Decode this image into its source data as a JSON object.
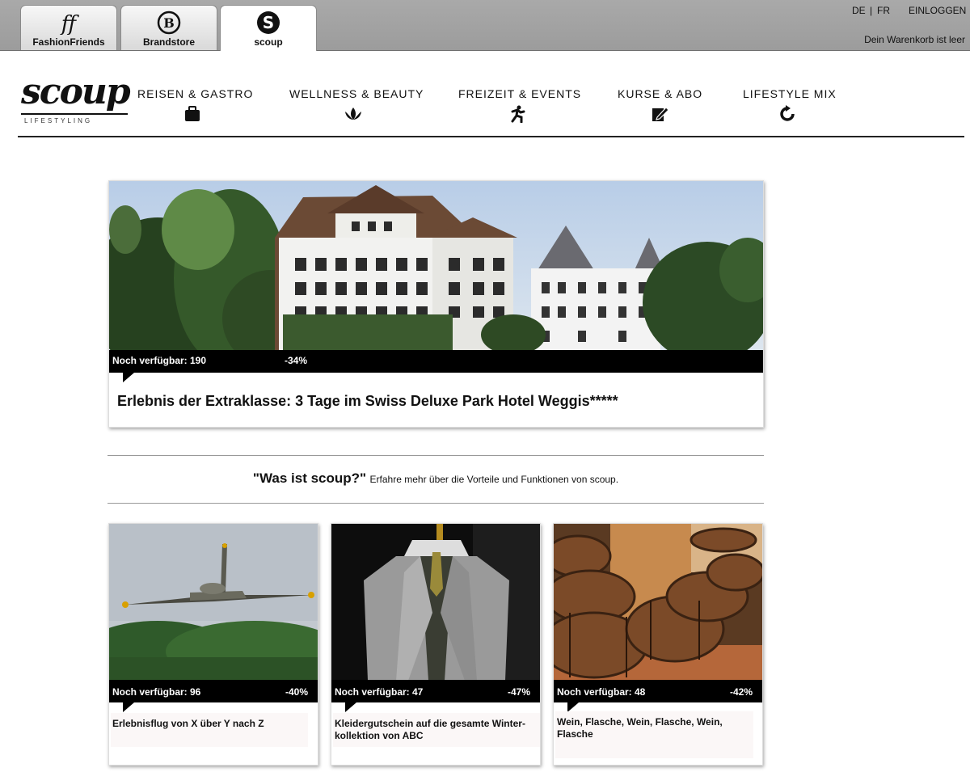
{
  "tabs": [
    {
      "label": "FashionFriends",
      "icon": "fashionfriends-logo-icon"
    },
    {
      "label": "Brandstore",
      "icon": "brandstore-logo-icon"
    },
    {
      "label": "scoup",
      "icon": "scoup-logo-icon"
    }
  ],
  "lang": {
    "de": "DE",
    "sep": "|",
    "fr": "FR"
  },
  "login": "EINLOGGEN",
  "cart": "Dein Warenkorb ist leer",
  "logo": {
    "word": "scoup",
    "sub": "LIFESTYLING"
  },
  "nav": [
    {
      "label": "REISEN & GASTRO",
      "icon": "suitcase-icon"
    },
    {
      "label": "WELLNESS & BEAUTY",
      "icon": "lotus-icon"
    },
    {
      "label": "FREIZEIT & EVENTS",
      "icon": "runner-icon"
    },
    {
      "label": "KURSE & ABO",
      "icon": "edit-pen-icon"
    },
    {
      "label": "LIFESTYLE MIX",
      "icon": "refresh-arrow-icon"
    }
  ],
  "hero": {
    "avail": "Noch verfügbar: 190",
    "discount": "-34%",
    "title": "Erlebnis der Extraklasse: 3 Tage im Swiss Deluxe Park Hotel Weggis*****"
  },
  "info": {
    "question": "\"Was ist scoup?\"",
    "text": "Erfahre mehr über die Vorteile und Funktionen von scoup."
  },
  "deals": [
    {
      "avail": "Noch verfügbar: 96",
      "discount": "-40%",
      "title": "Erlebnisflug von X über Y nach Z"
    },
    {
      "avail": "Noch verfügbar: 47",
      "discount": "-47%",
      "title": "Kleidergutschein auf die gesamte Winter-kollektion von ABC"
    },
    {
      "avail": "Noch verfügbar: 48",
      "discount": "-42%",
      "title": "Wein, Flasche, Wein, Flasche, Wein, Flasche"
    }
  ],
  "colors": {
    "topbar": "#a3a3a3",
    "band": "#000000",
    "sky": "#c6d6ea"
  }
}
